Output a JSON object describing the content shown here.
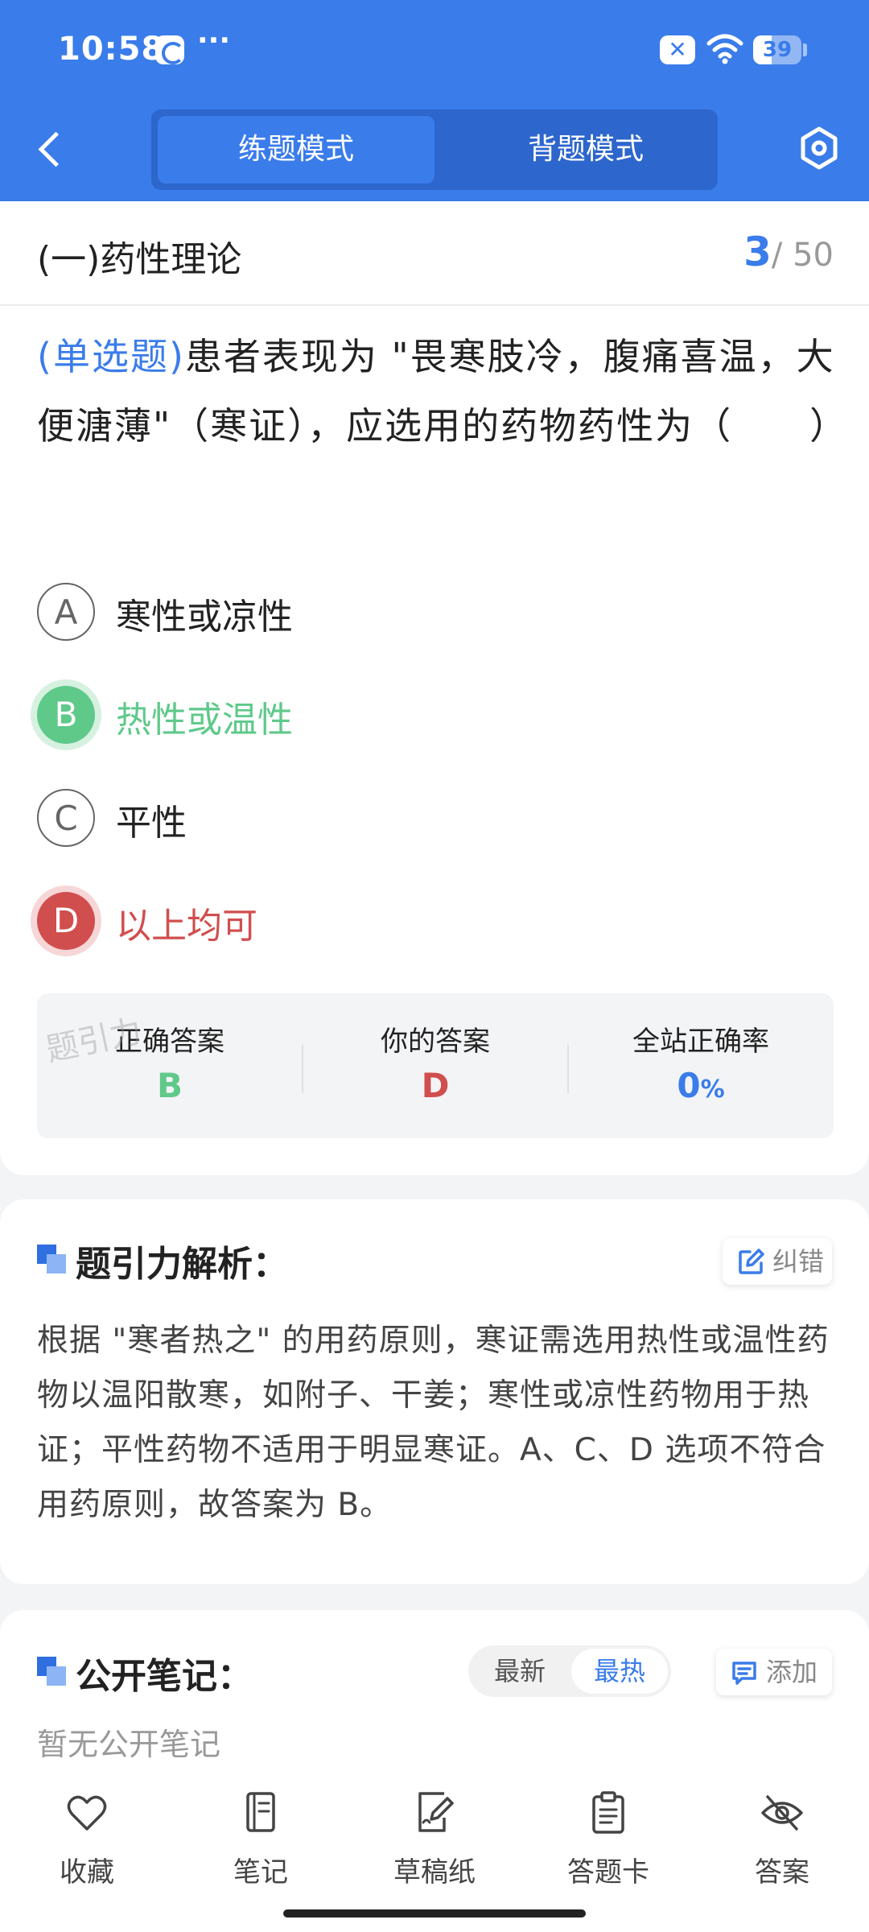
{
  "status_bar": {
    "time": "10:58",
    "more": "···",
    "battery": "39",
    "battery_level": 0.39
  },
  "header": {
    "tabs": [
      {
        "label": "练题模式",
        "active": true
      },
      {
        "label": "背题模式",
        "active": false
      }
    ]
  },
  "question": {
    "section": "(一)药性理论",
    "current": "3",
    "total": "/ 50",
    "type": "(单选题)",
    "text": "患者表现为 \"畏寒肢冷，腹痛喜温，大便溏薄\"（寒证），应选用的药物药性为（　　）",
    "options": [
      {
        "letter": "A",
        "text": "寒性或凉性",
        "state": "normal"
      },
      {
        "letter": "B",
        "text": "热性或温性",
        "state": "correct"
      },
      {
        "letter": "C",
        "text": "平性",
        "state": "normal"
      },
      {
        "letter": "D",
        "text": "以上均可",
        "state": "wrong"
      }
    ]
  },
  "answers": {
    "correct_label": "正确答案",
    "correct_value": "B",
    "yours_label": "你的答案",
    "yours_value": "D",
    "rate_label": "全站正确率",
    "rate_value": "0",
    "rate_unit": "%",
    "watermark": "题引力"
  },
  "analysis": {
    "title": "题引力解析：",
    "report_label": "纠错",
    "text": "根据 \"寒者热之\" 的用药原则，寒证需选用热性或温性药物以温阳散寒，如附子、干姜；寒性或凉性药物用于热证；平性药物不适用于明显寒证。A、C、D 选项不符合用药原则，故答案为 B。"
  },
  "notes": {
    "title": "公开笔记：",
    "sort_latest": "最新",
    "sort_hot": "最热",
    "add_label": "添加",
    "empty": "暂无公开笔记"
  },
  "bottom_nav": [
    {
      "label": "收藏",
      "icon": "heart-icon"
    },
    {
      "label": "笔记",
      "icon": "notebook-icon"
    },
    {
      "label": "草稿纸",
      "icon": "draft-icon"
    },
    {
      "label": "答题卡",
      "icon": "clipboard-icon"
    },
    {
      "label": "答案",
      "icon": "eye-off-icon"
    }
  ],
  "colors": {
    "primary": "#3a7cea",
    "correct": "#5fc98a",
    "wrong": "#d14e4e"
  }
}
